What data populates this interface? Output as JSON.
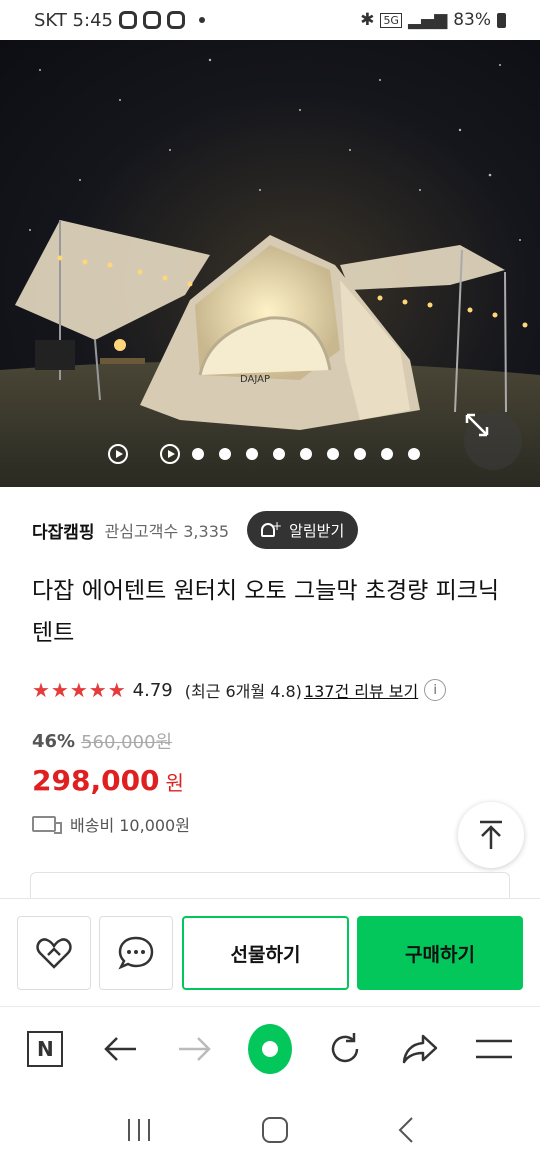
{
  "status_bar": {
    "carrier_time": "SKT 5:45",
    "network": "5G",
    "battery": "83%"
  },
  "hero": {
    "tent_brand": "DAJAP",
    "carousel": {
      "slide_count": 11,
      "active_index": 1
    }
  },
  "store": {
    "name": "다잡캠핑",
    "fans_label": "관심고객수 3,335",
    "alarm_label": "알림받기"
  },
  "product": {
    "title": "다잡 에어텐트 원터치 오토 그늘막 초경량 피크닉 텐트",
    "rating": {
      "stars": "★★★★★",
      "score": "4.79",
      "recent": "(최근 6개월 4.8)",
      "review_link": "137건 리뷰 보기",
      "info": "i"
    },
    "discount": "46%",
    "original_price": "560,000원",
    "price": "298,000",
    "currency": "원",
    "shipping": "배송비 10,000원"
  },
  "actions": {
    "gift_label": "선물하기",
    "buy_label": "구매하기"
  },
  "browser": {
    "logo": "N"
  },
  "colors": {
    "accent_green": "#03c75a",
    "price_red": "#e02020",
    "star_red": "#e43b3b"
  },
  "icons": [
    "n-logo-icon",
    "back-arrow-icon",
    "forward-arrow-icon",
    "home-icon",
    "refresh-icon",
    "share-icon",
    "menu-icon",
    "heart-icon",
    "talk-icon",
    "scroll-top-icon",
    "expand-icon",
    "truck-icon",
    "bell-icon"
  ]
}
